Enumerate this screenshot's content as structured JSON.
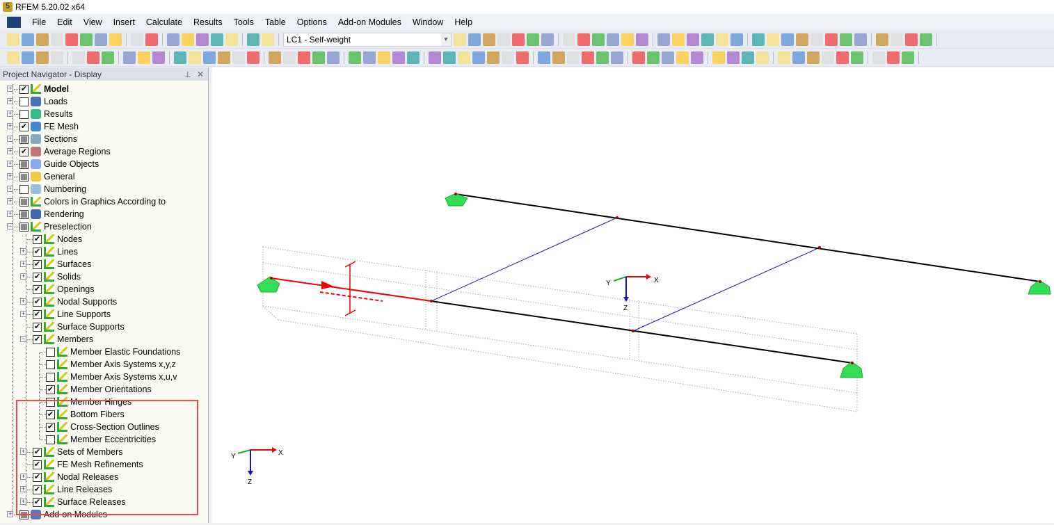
{
  "window": {
    "title": "RFEM 5.20.02 x64",
    "logo_text": "5"
  },
  "menu": [
    "File",
    "Edit",
    "View",
    "Insert",
    "Calculate",
    "Results",
    "Tools",
    "Table",
    "Options",
    "Add-on Modules",
    "Window",
    "Help"
  ],
  "toolbar": {
    "load_case": "LC1 - Self-weight"
  },
  "navigator": {
    "title": "Project Navigator - Display",
    "pin_icon": "pin-icon",
    "close_icon": "close-icon",
    "items": [
      {
        "label": "Model",
        "level": 0,
        "state": "checked",
        "expander": "+",
        "bold": true,
        "icon": "model-icon"
      },
      {
        "label": "Loads",
        "level": 0,
        "state": "unchecked",
        "expander": "+",
        "icon": "loads-icon"
      },
      {
        "label": "Results",
        "level": 0,
        "state": "unchecked",
        "expander": "+",
        "icon": "results-icon"
      },
      {
        "label": "FE Mesh",
        "level": 0,
        "state": "checked",
        "expander": "+",
        "icon": "fe-mesh-icon"
      },
      {
        "label": "Sections",
        "level": 0,
        "state": "partial",
        "expander": "+",
        "icon": "sections-icon"
      },
      {
        "label": "Average Regions",
        "level": 0,
        "state": "checked",
        "expander": "+",
        "icon": "average-regions-icon"
      },
      {
        "label": "Guide Objects",
        "level": 0,
        "state": "partial",
        "expander": "+",
        "icon": "guide-objects-icon"
      },
      {
        "label": "General",
        "level": 0,
        "state": "partial",
        "expander": "+",
        "icon": "general-icon"
      },
      {
        "label": "Numbering",
        "level": 0,
        "state": "unchecked",
        "expander": "+",
        "icon": "numbering-icon"
      },
      {
        "label": "Colors in Graphics According to",
        "level": 0,
        "state": "partial",
        "expander": "+",
        "icon": "colors-icon"
      },
      {
        "label": "Rendering",
        "level": 0,
        "state": "partial",
        "expander": "+",
        "icon": "rendering-icon"
      },
      {
        "label": "Preselection",
        "level": 0,
        "state": "partial",
        "expander": "-",
        "icon": "preselection-icon"
      },
      {
        "label": "Nodes",
        "level": 1,
        "state": "checked",
        "expander": "",
        "icon": "pen-icon"
      },
      {
        "label": "Lines",
        "level": 1,
        "state": "checked",
        "expander": "+",
        "icon": "pen-icon"
      },
      {
        "label": "Surfaces",
        "level": 1,
        "state": "checked",
        "expander": "+",
        "icon": "pen-icon"
      },
      {
        "label": "Solids",
        "level": 1,
        "state": "checked",
        "expander": "+",
        "icon": "pen-icon"
      },
      {
        "label": "Openings",
        "level": 1,
        "state": "checked",
        "expander": "",
        "icon": "pen-icon"
      },
      {
        "label": "Nodal Supports",
        "level": 1,
        "state": "checked",
        "expander": "+",
        "icon": "pen-icon"
      },
      {
        "label": "Line Supports",
        "level": 1,
        "state": "checked",
        "expander": "+",
        "icon": "pen-icon"
      },
      {
        "label": "Surface Supports",
        "level": 1,
        "state": "checked",
        "expander": "",
        "icon": "pen-icon"
      },
      {
        "label": "Members",
        "level": 1,
        "state": "checked",
        "expander": "-",
        "icon": "pen-icon"
      },
      {
        "label": "Member Elastic Foundations",
        "level": 2,
        "state": "unchecked",
        "expander": "",
        "icon": "pen-icon"
      },
      {
        "label": "Member Axis Systems x,y,z",
        "level": 2,
        "state": "unchecked",
        "expander": "",
        "icon": "pen-icon"
      },
      {
        "label": "Member Axis Systems x,u,v",
        "level": 2,
        "state": "unchecked",
        "expander": "",
        "icon": "pen-icon"
      },
      {
        "label": "Member Orientations",
        "level": 2,
        "state": "checked",
        "expander": "",
        "icon": "pen-icon"
      },
      {
        "label": "Member Hinges",
        "level": 2,
        "state": "unchecked",
        "expander": "",
        "icon": "pen-icon"
      },
      {
        "label": "Bottom Fibers",
        "level": 2,
        "state": "checked",
        "expander": "",
        "icon": "pen-icon"
      },
      {
        "label": "Cross-Section Outlines",
        "level": 2,
        "state": "checked",
        "expander": "",
        "icon": "pen-icon"
      },
      {
        "label": "Member Eccentricities",
        "level": 2,
        "state": "unchecked",
        "expander": "",
        "icon": "pen-icon"
      },
      {
        "label": "Sets of Members",
        "level": 1,
        "state": "checked",
        "expander": "+",
        "icon": "pen-icon"
      },
      {
        "label": "FE Mesh Refinements",
        "level": 1,
        "state": "checked",
        "expander": "",
        "icon": "pen-icon"
      },
      {
        "label": "Nodal Releases",
        "level": 1,
        "state": "checked",
        "expander": "+",
        "icon": "pen-icon"
      },
      {
        "label": "Line Releases",
        "level": 1,
        "state": "checked",
        "expander": "+",
        "icon": "pen-icon"
      },
      {
        "label": "Surface Releases",
        "level": 1,
        "state": "checked",
        "expander": "+",
        "icon": "pen-icon"
      },
      {
        "label": "Add-on Modules",
        "level": 0,
        "state": "partial",
        "expander": "+",
        "icon": "add-on-modules-icon"
      }
    ]
  },
  "viewport": {
    "axis_labels": {
      "x": "X",
      "y": "Y",
      "z": "Z"
    },
    "colors": {
      "member": "#000000",
      "highlight": "#e00000",
      "line": "#1a1aa0",
      "support": "#33dd55"
    }
  }
}
